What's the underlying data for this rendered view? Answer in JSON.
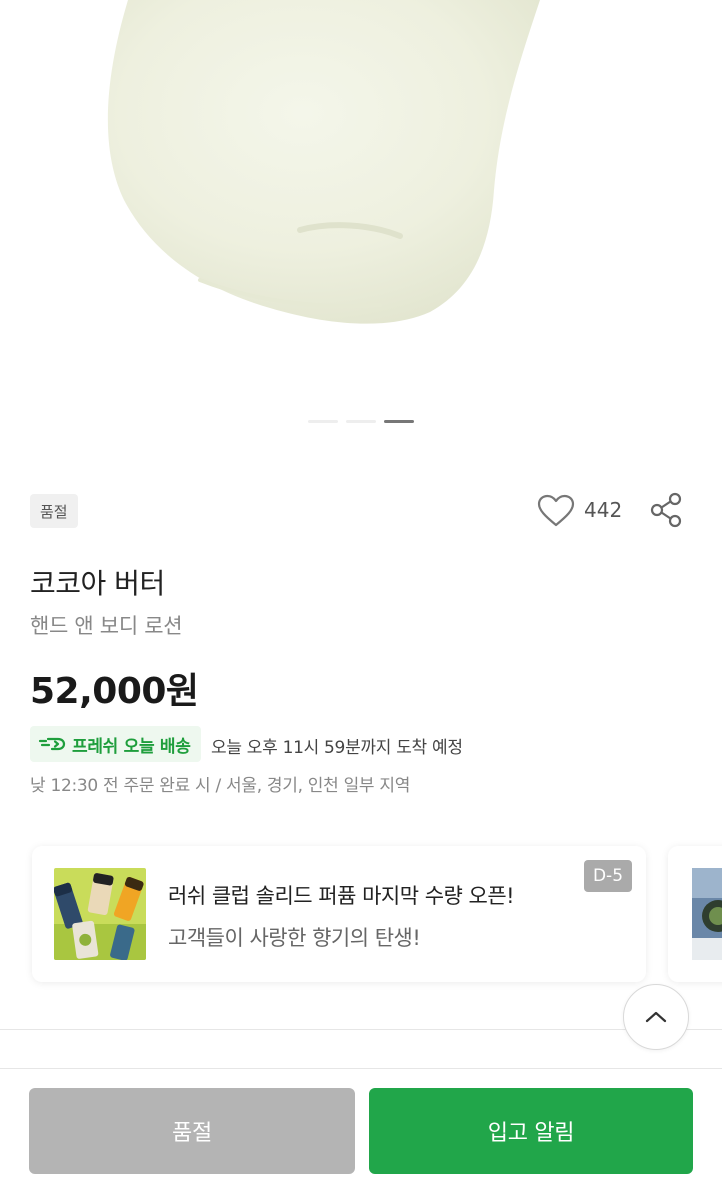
{
  "product": {
    "status_badge": "품절",
    "like_count": "442",
    "name": "코코아 버터",
    "category": "핸드 앤 보디 로션",
    "price": "52,000원",
    "image_index": {
      "current": 3,
      "total": 3
    }
  },
  "delivery": {
    "badge_label": "프레쉬 오늘 배송",
    "eta": "오늘 오후 11시 59분까지 도착 예정",
    "note": "낮 12:30 전 주문 완료 시 / 서울, 경기, 인천 일부 지역"
  },
  "promo": {
    "title": "러쉬 클럽 솔리드 퍼퓸 마지막 수량 오픈!",
    "subtitle": "고객들이 사랑한 향기의 탄생!",
    "d_day": "D-5"
  },
  "actions": {
    "sold_out_label": "품절",
    "notify_label": "입고 알림"
  },
  "icons": [
    "heart-icon",
    "share-icon",
    "fresh-delivery-icon",
    "chevron-up-icon"
  ],
  "colors": {
    "accent_green": "#21a64a",
    "fresh_text": "#1e9e3c",
    "fresh_bg": "#eef8ef",
    "disabled_button": "#b4b4b4"
  }
}
